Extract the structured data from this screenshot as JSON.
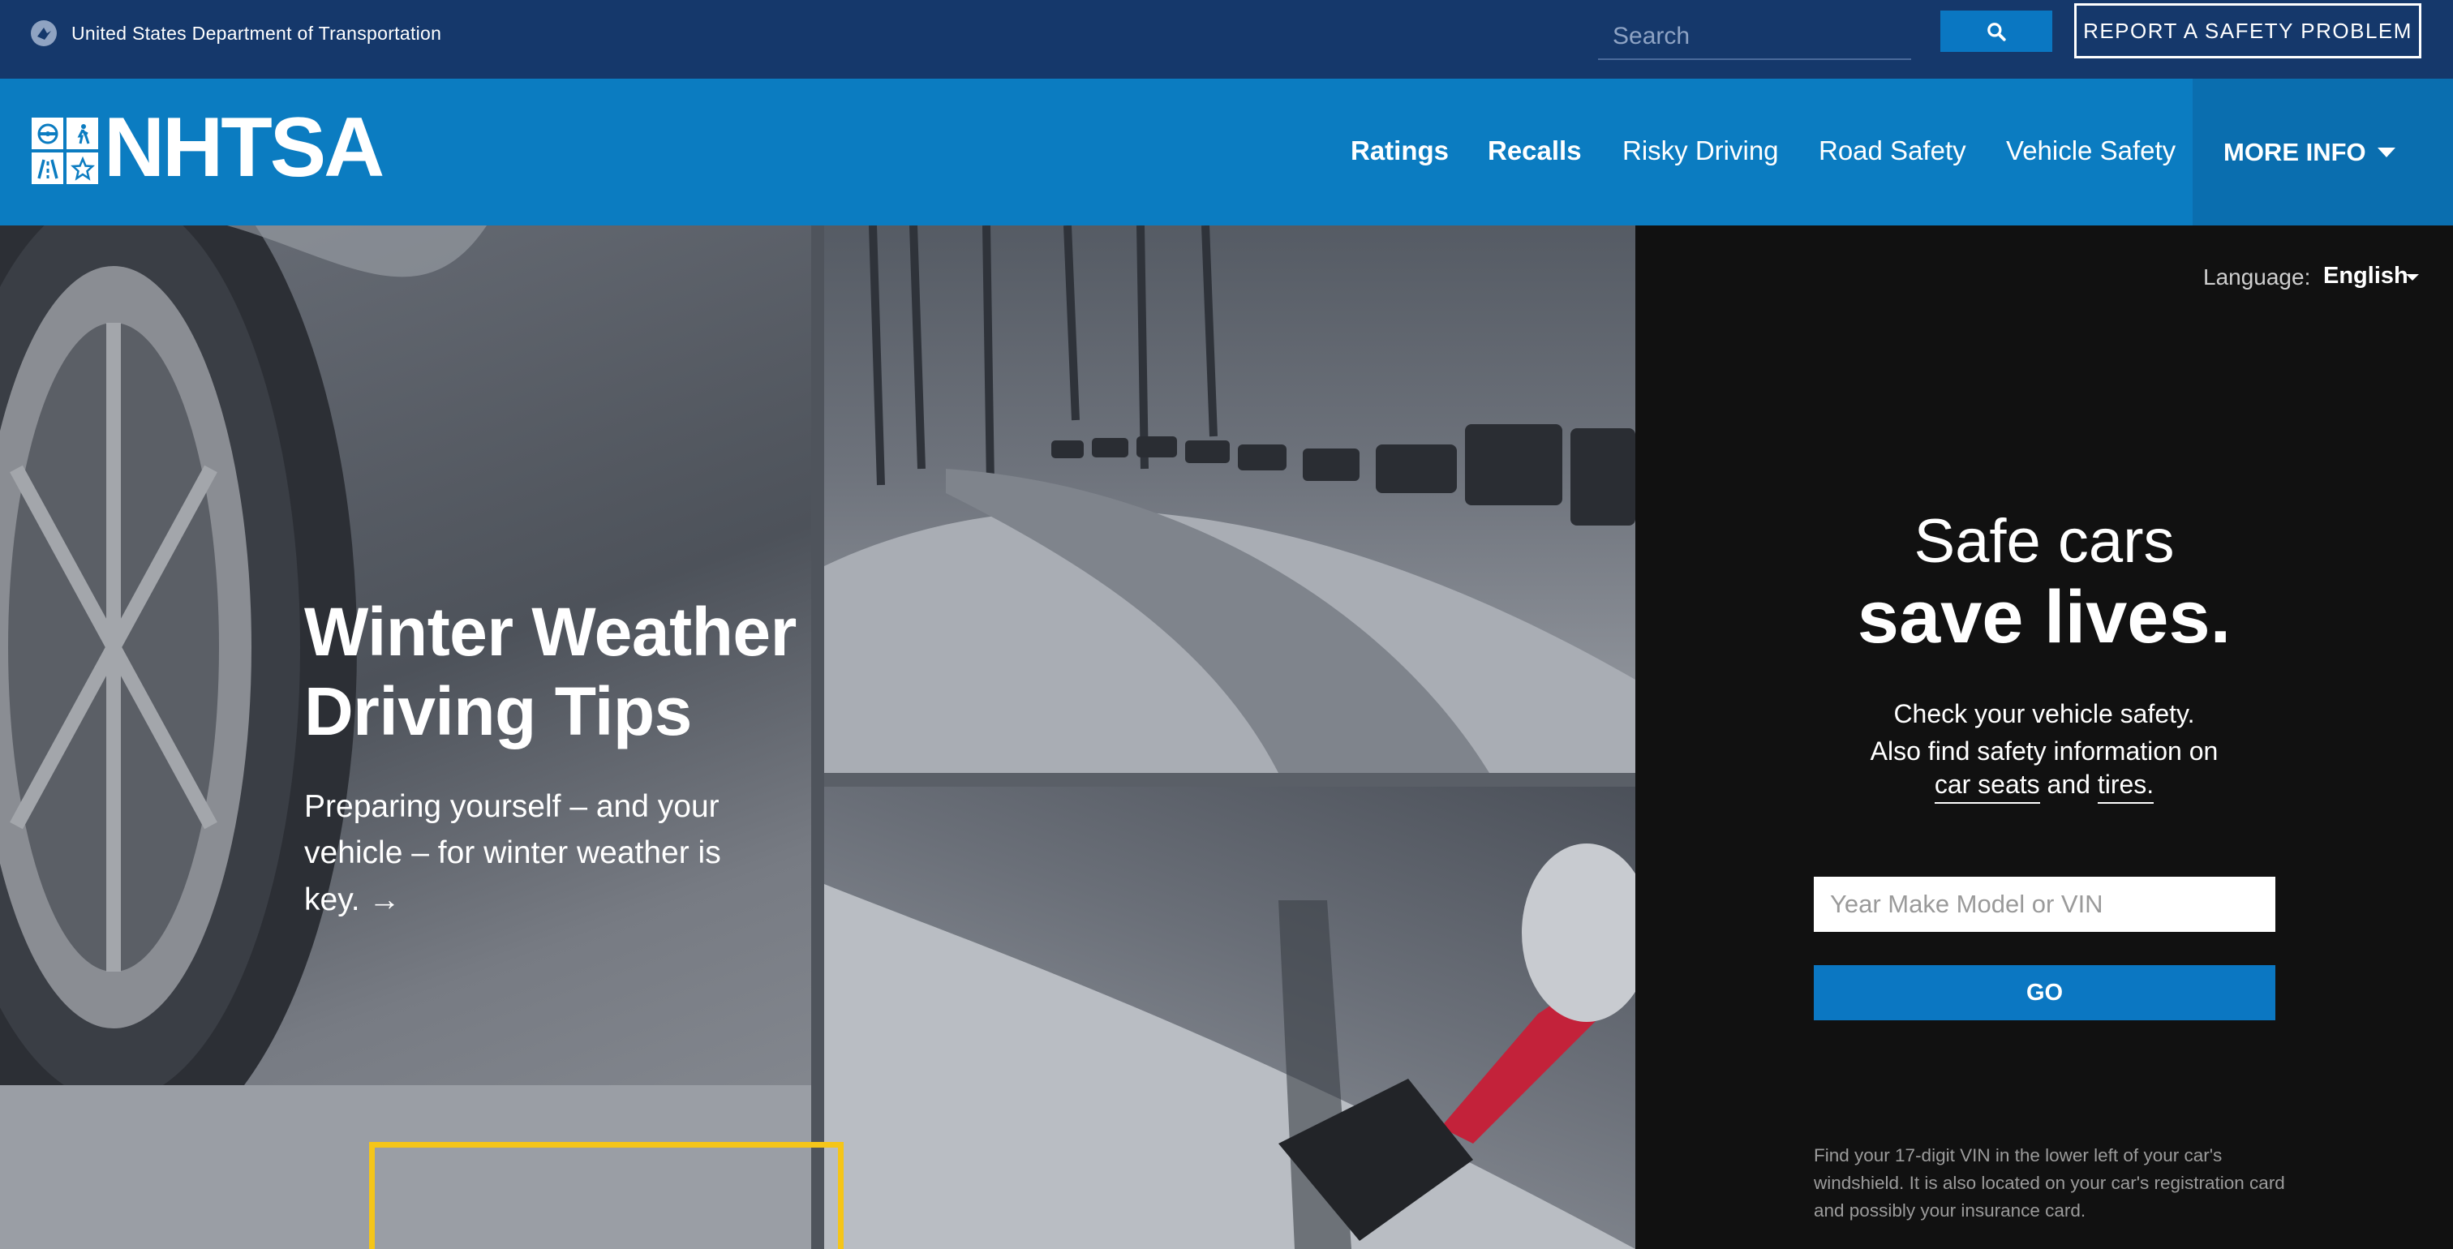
{
  "topbar": {
    "agency_name": "United States Department of Transportation",
    "search_placeholder": "Search",
    "report_label": "REPORT A SAFETY PROBLEM"
  },
  "nav": {
    "logo_text": "NHTSA",
    "items": [
      {
        "label": "Ratings",
        "bold": true
      },
      {
        "label": "Recalls",
        "bold": true
      },
      {
        "label": "Risky Driving",
        "bold": false
      },
      {
        "label": "Road Safety",
        "bold": false
      },
      {
        "label": "Vehicle Safety",
        "bold": false
      }
    ],
    "more_info_label": "MORE INFO"
  },
  "hero": {
    "title_line1": "Winter Weather",
    "title_line2": "Driving Tips",
    "subtitle": "Preparing yourself – and your vehicle – for winter weather is key. →"
  },
  "panel": {
    "language_label": "Language:",
    "language_value": "English",
    "tagline_line1": "Safe cars",
    "tagline_line2": "save lives.",
    "check_line1": "Check your vehicle safety.",
    "check_line2": "Also find safety information on",
    "link_car_seats": "car seats",
    "link_and": "and",
    "link_tires": "tires.",
    "vin_placeholder": "Year Make Model or VIN",
    "go_label": "GO",
    "vin_help": "Find your 17-digit VIN in the lower left of your car's windshield. It is also located on your car's registration card and possibly your insurance card."
  },
  "colors": {
    "topbar_bg": "#15386b",
    "nav_bg": "#0b7cc1",
    "more_info_bg": "#0a6eaf",
    "accent_button": "#0b77c2",
    "highlight_box": "#f5c518",
    "panel_bg": "#111111"
  },
  "icons": [
    "dot-seal-icon",
    "search-icon",
    "steering-wheel-icon",
    "pedestrian-icon",
    "road-icon",
    "star-icon",
    "chevron-down-icon",
    "arrow-right-icon"
  ]
}
